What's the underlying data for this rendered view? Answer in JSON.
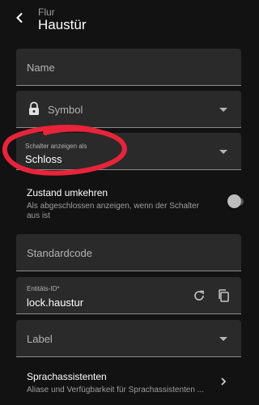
{
  "header": {
    "breadcrumb": "Flur",
    "title": "Haustür"
  },
  "form": {
    "name_label": "Name",
    "symbol_label": "Symbol",
    "switch_label": "Schalter anzeigen als",
    "switch_value": "Schloss",
    "invert_title": "Zustand umkehren",
    "invert_desc_line1": "Als abgeschlossen anzeigen, wenn der Schalter",
    "invert_desc_line2": "aus ist",
    "invert_on": false,
    "default_code_label": "Standardcode",
    "entity_id_label": "Entitäts-ID*",
    "entity_id_value": "lock.haustur",
    "label_label": "Label",
    "voice_title": "Sprachassistenten",
    "voice_desc": "Aliase und Verfügbarkeit für Sprachassistenten ..."
  },
  "colors": {
    "highlight": "#e8243a",
    "field_bg": "#2a2a2a",
    "background": "#121212"
  },
  "icons": [
    "back-arrow-icon",
    "lock-icon",
    "chevron-down-icon",
    "refresh-icon",
    "copy-icon",
    "chevron-right-icon"
  ]
}
